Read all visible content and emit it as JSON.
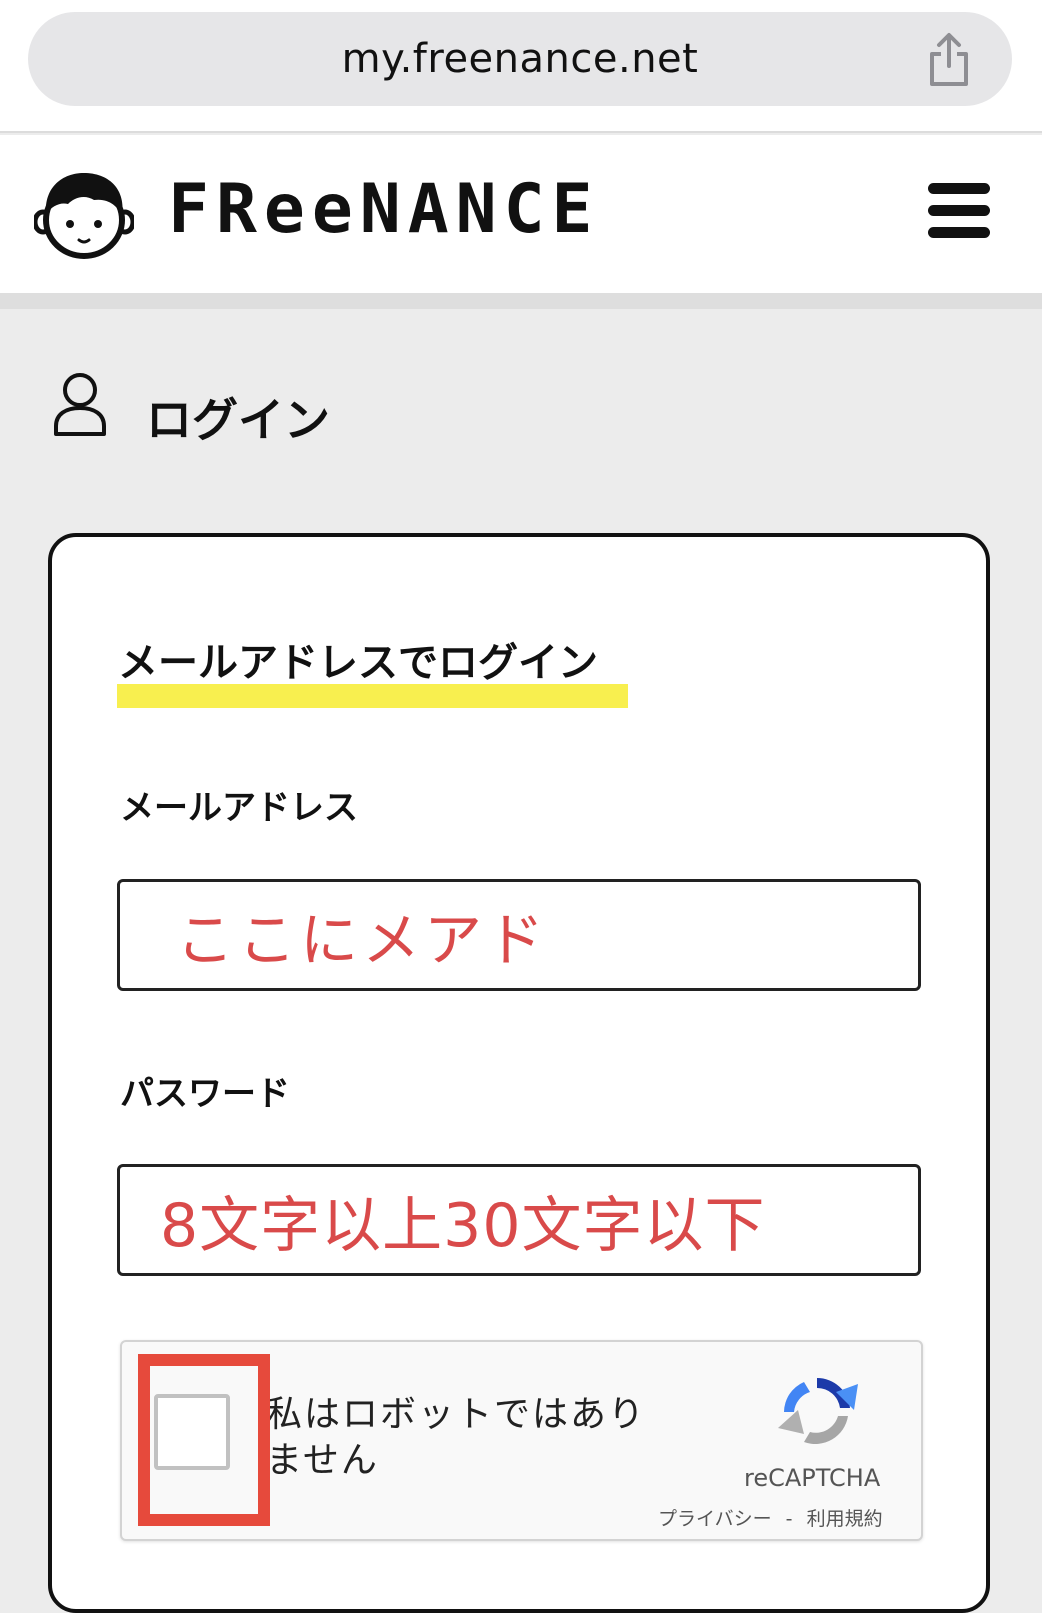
{
  "browser": {
    "url": "my.freenance.net"
  },
  "header": {
    "brand": "FReeNANCE"
  },
  "page": {
    "title": "ログイン"
  },
  "login_form": {
    "section_heading": "メールアドレスでログイン",
    "email_label": "メールアドレス",
    "email_value": "ここにメアド",
    "password_label": "パスワード",
    "password_value": "8文字以上30文字以下"
  },
  "recaptcha": {
    "checkbox_label": "私はロボットではありません",
    "brand": "reCAPTCHA",
    "privacy_link": "プライバシー",
    "separator": "-",
    "terms_link": "利用規約"
  },
  "colors": {
    "accent_underline": "#f8ef4f",
    "input_text": "#d94a4a",
    "highlight": "#e64a3c"
  }
}
